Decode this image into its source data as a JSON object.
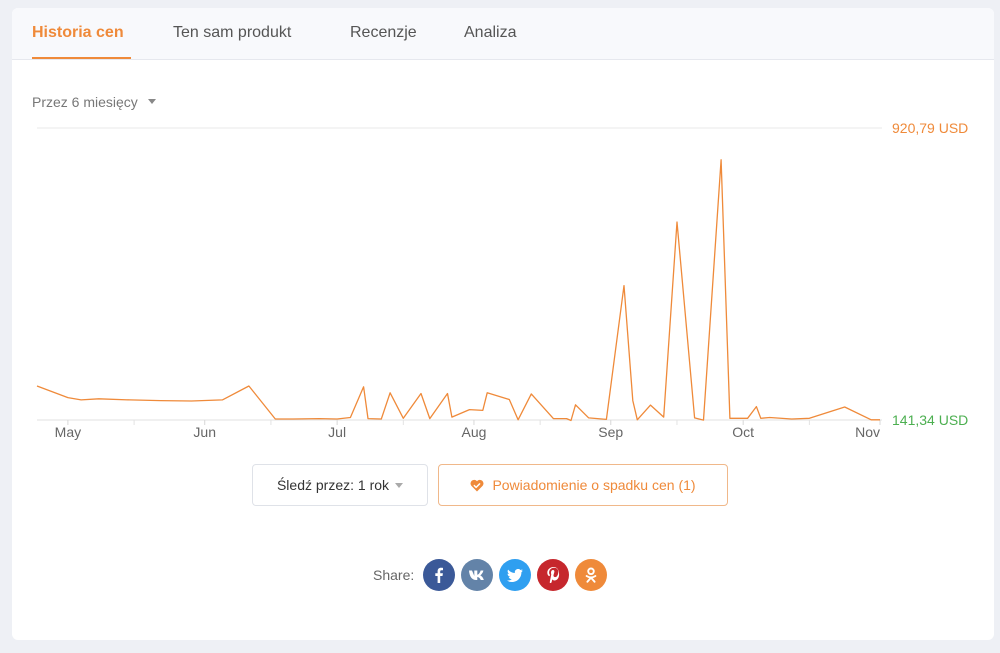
{
  "tabs": [
    {
      "label": "Historia cen",
      "active": true
    },
    {
      "label": "Ten sam produkt",
      "active": false
    },
    {
      "label": "Recenzje",
      "active": false
    },
    {
      "label": "Analiza",
      "active": false
    }
  ],
  "period_selector": {
    "label": "Przez 6 miesięcy"
  },
  "chart_data": {
    "type": "line",
    "x_tick_labels": [
      "May",
      "Jun",
      "Jul",
      "Aug",
      "Sep",
      "Oct",
      "Nov"
    ],
    "max_label": "920,79 USD",
    "min_label": "141,34 USD",
    "ylim": [
      141.34,
      920.79
    ],
    "colors": {
      "line": "#ef8a3a",
      "max": "#ef8a3a",
      "min": "#4caf50"
    },
    "x": [
      "2023-04-24",
      "2023-05-01",
      "2023-05-04",
      "2023-05-08",
      "2023-05-15",
      "2023-05-22",
      "2023-05-29",
      "2023-06-05",
      "2023-06-11",
      "2023-06-17",
      "2023-06-21",
      "2023-06-27",
      "2023-07-01",
      "2023-07-04",
      "2023-07-07",
      "2023-07-08",
      "2023-07-11",
      "2023-07-13",
      "2023-07-16",
      "2023-07-20",
      "2023-07-22",
      "2023-07-26",
      "2023-07-27",
      "2023-07-31",
      "2023-08-03",
      "2023-08-04",
      "2023-08-09",
      "2023-08-11",
      "2023-08-14",
      "2023-08-19",
      "2023-08-22",
      "2023-08-23",
      "2023-08-24",
      "2023-08-27",
      "2023-08-31",
      "2023-09-04",
      "2023-09-06",
      "2023-09-07",
      "2023-09-10",
      "2023-09-13",
      "2023-09-16",
      "2023-09-20",
      "2023-09-22",
      "2023-09-26",
      "2023-09-28",
      "2023-10-02",
      "2023-10-04",
      "2023-10-05",
      "2023-10-07",
      "2023-10-12",
      "2023-10-16",
      "2023-10-24",
      "2023-10-30",
      "2023-11-01"
    ],
    "y": [
      232,
      201,
      195,
      198,
      195,
      193,
      192,
      195,
      232,
      144,
      144,
      145,
      144,
      148,
      230,
      145,
      144,
      214,
      146,
      212,
      145,
      212,
      149,
      169,
      167,
      214,
      196,
      142,
      211,
      145,
      145,
      140,
      182,
      147,
      143,
      500,
      193,
      142,
      181,
      149,
      670,
      147,
      141,
      836,
      146,
      146,
      177,
      146,
      148,
      144,
      146,
      176,
      142,
      142
    ]
  },
  "track_button": {
    "label": "Śledź przez: 1 rok"
  },
  "notify_button": {
    "label": "Powiadomienie o spadku cen (1)"
  },
  "share": {
    "label": "Share:",
    "networks": [
      {
        "name": "facebook",
        "icon": "facebook-icon",
        "color": "#3b5998"
      },
      {
        "name": "vk",
        "icon": "vk-icon",
        "color": "#6383a8"
      },
      {
        "name": "twitter",
        "icon": "twitter-icon",
        "color": "#2f9ff0"
      },
      {
        "name": "pinterest",
        "icon": "pinterest-icon",
        "color": "#c6272d"
      },
      {
        "name": "odnoklassniki",
        "icon": "odnoklassniki-icon",
        "color": "#ef8a3a"
      }
    ]
  }
}
